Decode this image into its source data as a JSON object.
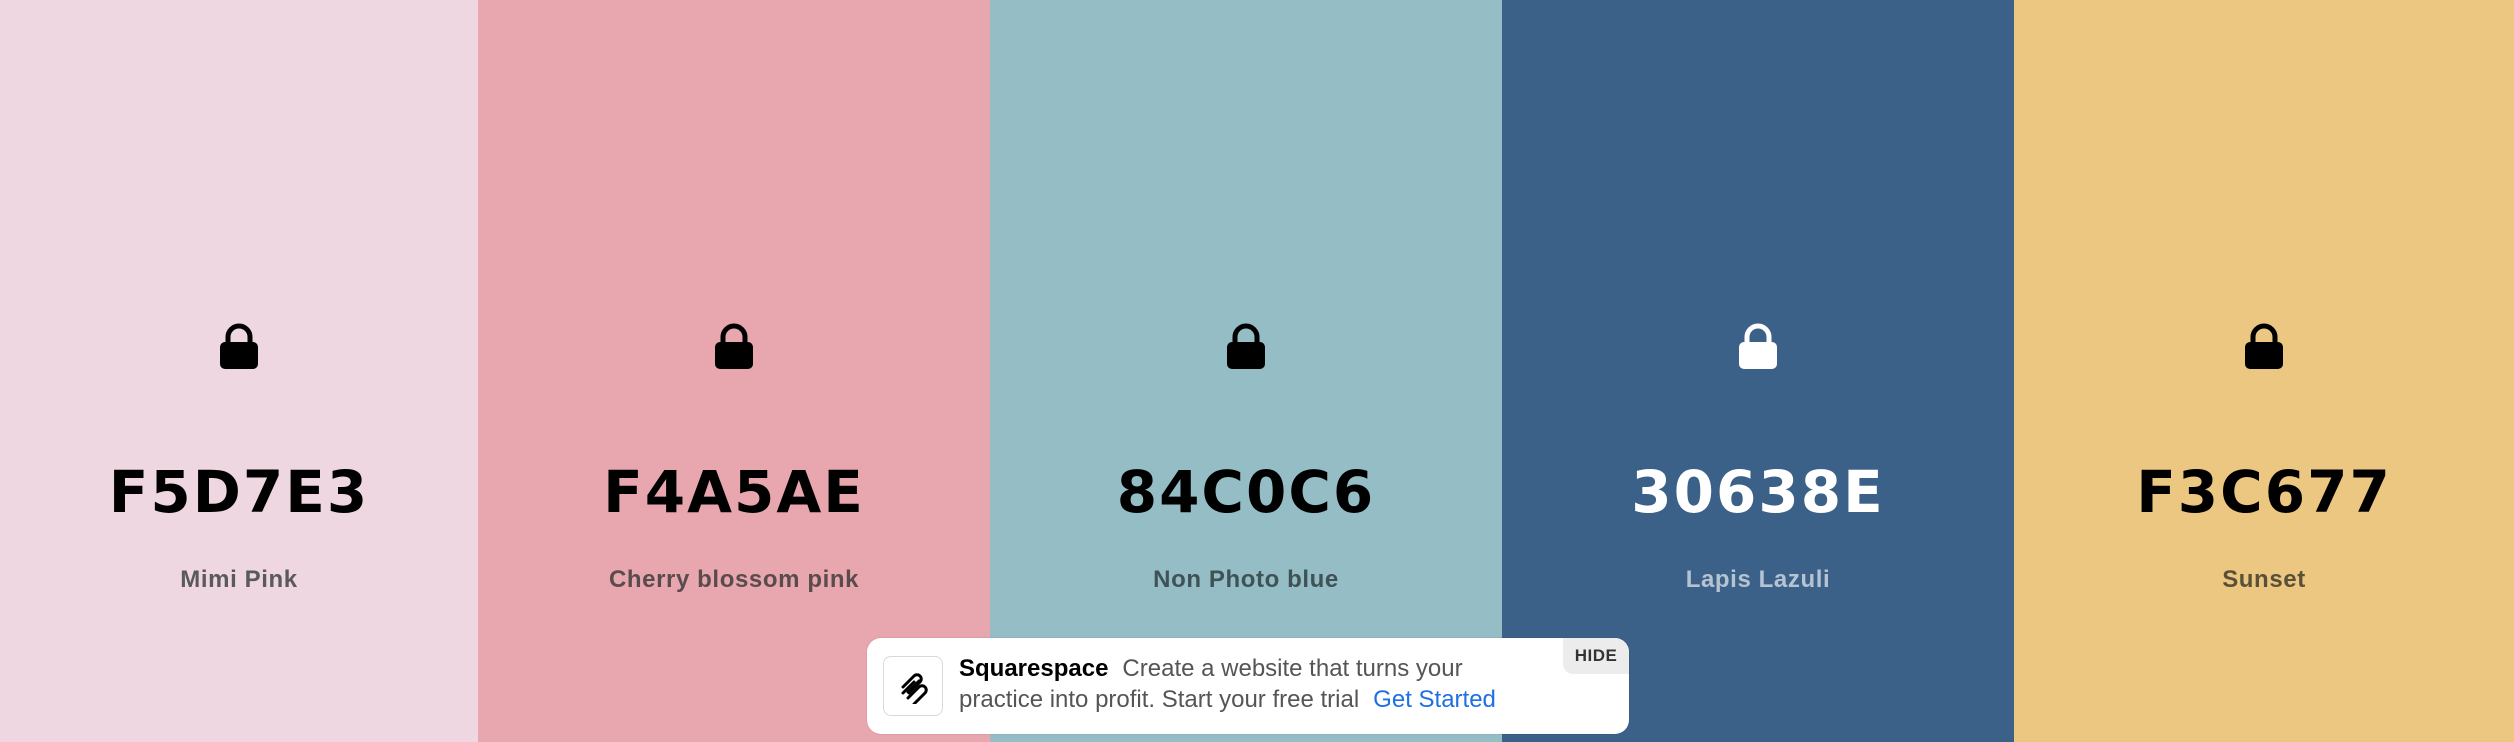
{
  "palette": {
    "colors": [
      {
        "hex": "F5D7E3",
        "name": "Mimi Pink",
        "background": "#EFD7E2",
        "text_color": "#000000",
        "name_color": "#5a5a5a",
        "icon": "lock-icon",
        "icon_color": "#000000"
      },
      {
        "hex": "F4A5AE",
        "name": "Cherry blossom pink",
        "background": "#E8A7AF",
        "text_color": "#000000",
        "name_color": "#5a4b4d",
        "icon": "lock-icon",
        "icon_color": "#000000"
      },
      {
        "hex": "84C0C6",
        "name": "Non Photo blue",
        "background": "#94BDC5",
        "text_color": "#000000",
        "name_color": "#3f5255",
        "icon": "lock-icon",
        "icon_color": "#000000"
      },
      {
        "hex": "30638E",
        "name": "Lapis Lazuli",
        "background": "#3C6189",
        "text_color": "#FFFFFF",
        "name_color": "#b5c3d2",
        "icon": "lock-icon",
        "icon_color": "#FFFFFF"
      },
      {
        "hex": "F3C677",
        "name": "Sunset",
        "background": "#ECC782",
        "text_color": "#000000",
        "name_color": "#5a5038",
        "icon": "lock-icon",
        "icon_color": "#000000"
      }
    ]
  },
  "ad": {
    "brand": "Squarespace",
    "text": "Create a website that turns your practice into profit. Start your free trial",
    "cta": "Get Started",
    "hide_label": "HIDE",
    "logo_icon": "squarespace-logo-icon",
    "cta_color": "#1f6fe5"
  }
}
